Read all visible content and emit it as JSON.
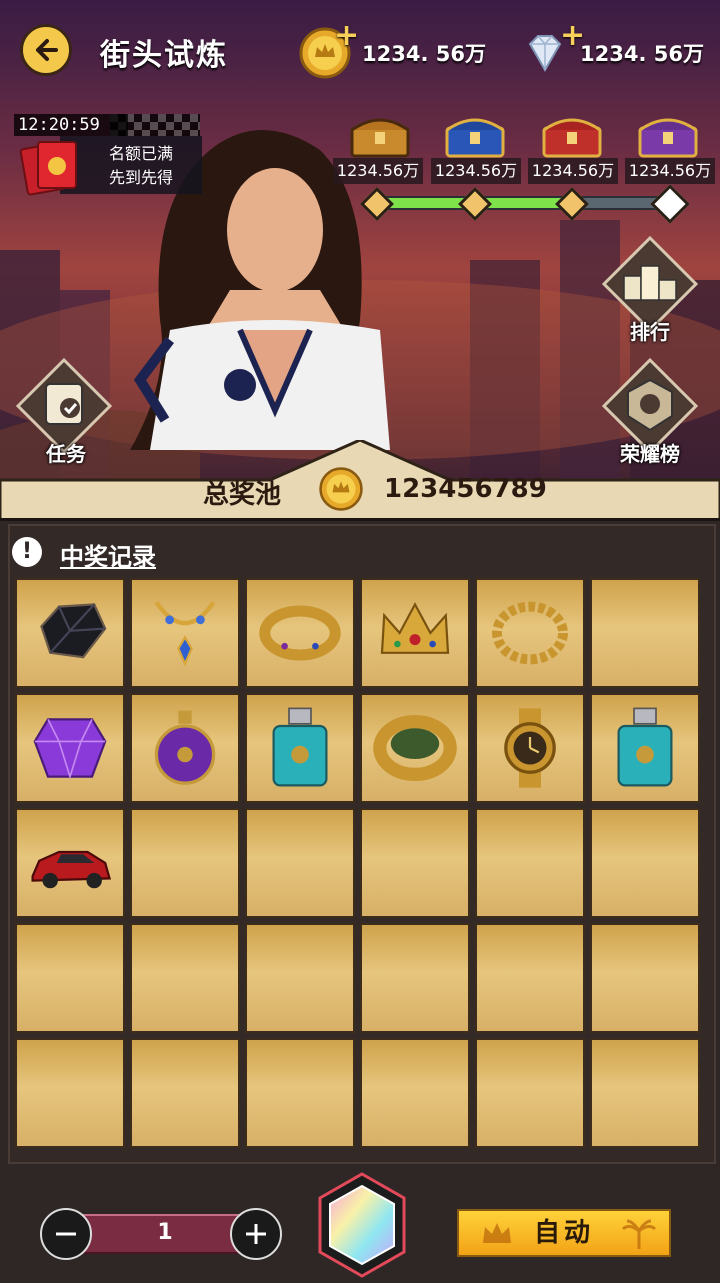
{
  "header": {
    "title": "街头试炼",
    "gold_value": "1234. 56万",
    "diamond_value": "1234. 56万"
  },
  "event": {
    "timer": "12:20:59",
    "notice_line1": "名额已满",
    "notice_line2": "先到先得"
  },
  "chests": [
    {
      "value": "1234.56万",
      "color": "#c98a2e"
    },
    {
      "value": "1234.56万",
      "color": "#2a56b8"
    },
    {
      "value": "1234.56万",
      "color": "#c0302b"
    },
    {
      "value": "1234.56万",
      "color": "#7a3aa8"
    }
  ],
  "progress": {
    "fraction": 0.67
  },
  "side_buttons": {
    "rank_label": "排行",
    "task_label": "任务",
    "honor_label": "荣耀榜"
  },
  "pool": {
    "label": "总奖池",
    "value": "123456789"
  },
  "records": {
    "title": "中奖记录",
    "rows": [
      [
        "black-gem-icon",
        "necklace-icon",
        "gold-ring-icon",
        "crown-icon",
        "gold-chain-icon",
        ""
      ],
      [
        "purple-gem-icon",
        "purple-perfume-icon",
        "blue-perfume-icon",
        "jade-ring-icon",
        "gold-watch-icon",
        "blue-perfume-icon"
      ],
      [
        "red-car-icon",
        "",
        "",
        "",
        "",
        ""
      ],
      [
        "",
        "",
        "",
        "",
        "",
        ""
      ],
      [
        "",
        "",
        "",
        "",
        "",
        ""
      ]
    ]
  },
  "controls": {
    "quantity": "1",
    "auto_label": "自动"
  },
  "colors": {
    "accent_gold": "#f3c84b",
    "progress_green": "#7ee24b",
    "cell_gold": "#e6c57d"
  }
}
